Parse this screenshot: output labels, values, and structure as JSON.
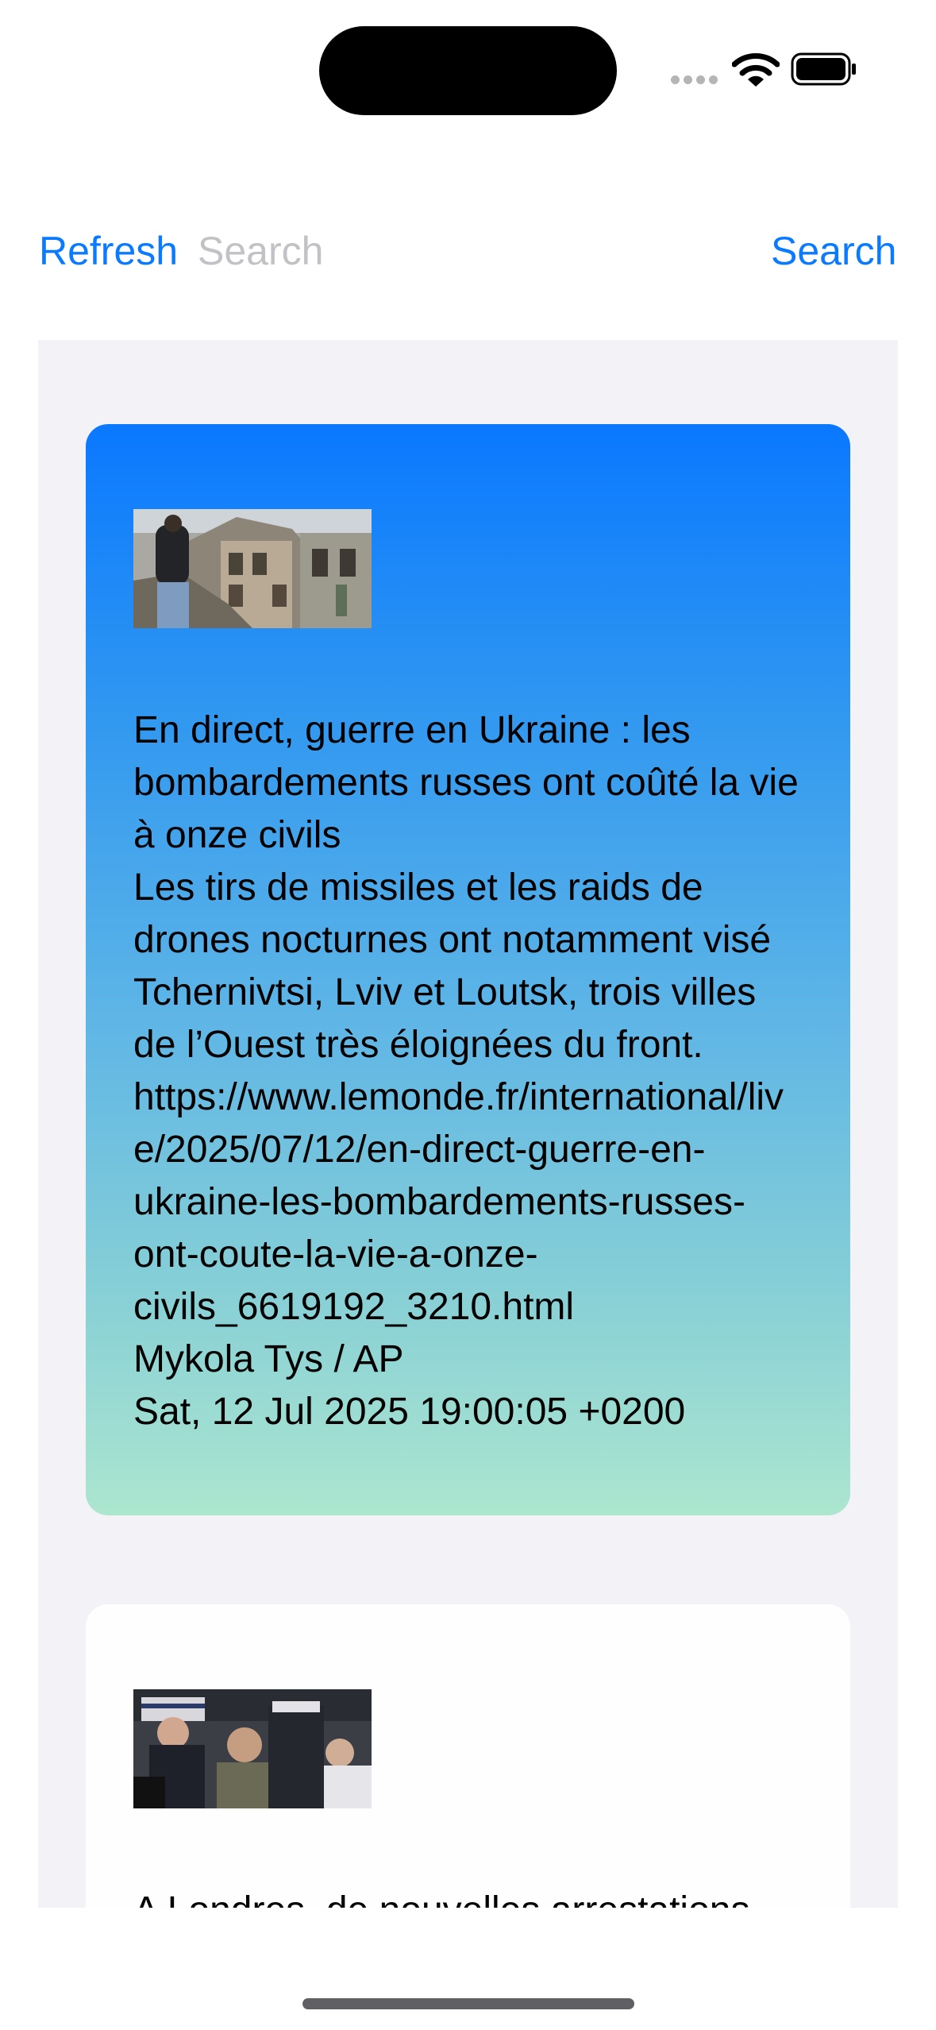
{
  "status_bar": {
    "icons": [
      "cellular-signal-icon",
      "wifi-icon",
      "battery-icon"
    ]
  },
  "toolbar": {
    "refresh_label": "Refresh",
    "search_placeholder": "Search",
    "search_value": "",
    "search_label": "Search"
  },
  "articles": [
    {
      "image": "destroyed-building-photo",
      "title": "En direct, guerre en Ukraine : les bombardements russes ont coûté la vie à onze civils",
      "description": "Les tirs de missiles et les raids de drones nocturnes ont notamment visé Tchernivtsi, Lviv et Loutsk, trois villes de l’Ouest très éloignées du front.",
      "link": "https://www.lemonde.fr/international/live/2025/07/12/en-direct-guerre-en-ukraine-les-bombardements-russes-ont-coute-la-vie-a-onze-civils_6619192_3210.html",
      "credit": "Mykola Tys / AP",
      "date": "Sat, 12 Jul 2025 19:00:05 +0200"
    },
    {
      "image": "police-arrest-photo",
      "title": "A Londres, de nouvelles arrestations"
    }
  ],
  "colors": {
    "accent": "#0a7aff",
    "placeholder": "#c2c2c6",
    "list_background": "#f2f2f7",
    "card_gradient_top": "#0a78ff",
    "card_gradient_bottom": "#ace6cf"
  }
}
